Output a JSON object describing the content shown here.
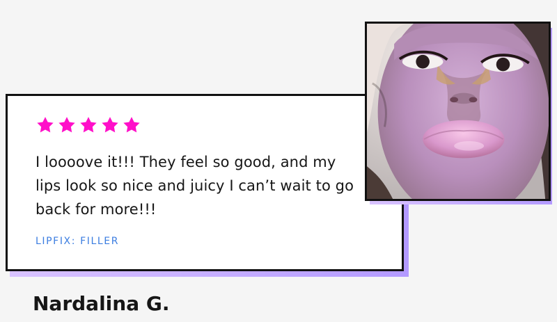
{
  "review": {
    "rating": 5,
    "rating_max": 5,
    "text": "I loooove it!!! They feel so good, and my lips look so nice and juicy I can’t wait to go back for more!!!",
    "product": "LIPFIX: FILLER"
  },
  "reviewer": {
    "name": "Nardalina G."
  },
  "colors": {
    "star": "#ff10c9",
    "link": "#3b7de0",
    "border": "#111111",
    "shadow_start": "#d9c3ff",
    "shadow_end": "#b39aff",
    "page_background": "#f5f5f5",
    "card_background": "#ffffff"
  },
  "icons": {
    "rating": "star-icon"
  }
}
